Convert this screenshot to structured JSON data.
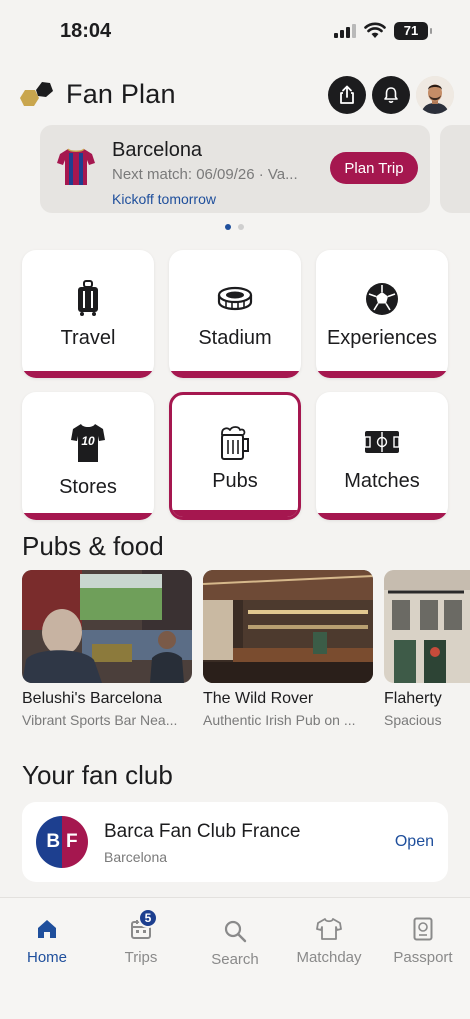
{
  "status_bar": {
    "time": "18:04",
    "battery": "71"
  },
  "header": {
    "title": "Fan Plan"
  },
  "match_card": {
    "team": "Barcelona",
    "next_match": "Next match: 06/09/26 · Va...",
    "kickoff": "Kickoff tomorrow",
    "plan_trip_label": "Plan Trip"
  },
  "carousel": {
    "pages": 2,
    "active": 1
  },
  "categories": [
    {
      "label": "Travel",
      "icon": "luggage-icon"
    },
    {
      "label": "Stadium",
      "icon": "stadium-icon"
    },
    {
      "label": "Experiences",
      "icon": "soccer-ball-icon"
    },
    {
      "label": "Stores",
      "icon": "jersey-icon",
      "jersey_number": "10"
    },
    {
      "label": "Pubs",
      "icon": "beer-mug-icon",
      "selected": true
    },
    {
      "label": "Matches",
      "icon": "pitch-icon"
    }
  ],
  "pubs_section": {
    "title": "Pubs & food",
    "items": [
      {
        "name": "Belushi's Barcelona",
        "description": "Vibrant Sports Bar Nea..."
      },
      {
        "name": "The Wild Rover",
        "description": "Authentic Irish Pub on ..."
      },
      {
        "name": "Flaherty",
        "description": "Spacious"
      }
    ]
  },
  "fan_club": {
    "title": "Your fan club",
    "badge": "BF",
    "name": "Barca Fan Club France",
    "city": "Barcelona",
    "action": "Open"
  },
  "tabs": [
    {
      "label": "Home",
      "icon": "home-icon",
      "active": true
    },
    {
      "label": "Trips",
      "icon": "calendar-icon",
      "badge": "5"
    },
    {
      "label": "Search",
      "icon": "search-icon"
    },
    {
      "label": "Matchday",
      "icon": "shirt-icon"
    },
    {
      "label": "Passport",
      "icon": "passport-icon"
    }
  ],
  "colors": {
    "accent": "#a5174f",
    "link": "#1f4f9c",
    "club_blue": "#1d3f8f"
  }
}
